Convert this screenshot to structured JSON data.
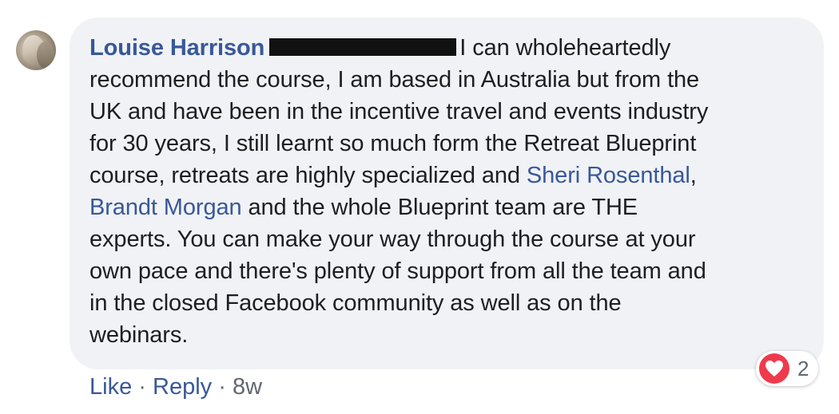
{
  "comment": {
    "author": "Louise Harrison",
    "lines": [
      "I can wholeheartedly",
      "recommend the course, I am based in Australia but from the",
      "UK and have been in the incentive travel and events industry",
      "for 30 years, I still learnt so much form the Retreat Blueprint",
      "course, retreats are highly specialized and ",
      "and the whole Blueprint team are THE",
      "experts. You can make your way through the course at your",
      "own pace and there's plenty of support from all the team and",
      "in the closed Facebook community as well as on the",
      "webinars."
    ],
    "mentions": [
      "Sheri Rosenthal",
      "Brandt Morgan"
    ],
    "comma_after_mention": ","
  },
  "actions": {
    "like": "Like",
    "separator": "·",
    "reply": "Reply",
    "time": "8w"
  },
  "reactions": {
    "icon": "heart-icon",
    "count": "2",
    "color": "#ef3a4c"
  },
  "colors": {
    "link": "#385898",
    "text": "#1c1e21",
    "bubble": "#f0f2f5"
  }
}
